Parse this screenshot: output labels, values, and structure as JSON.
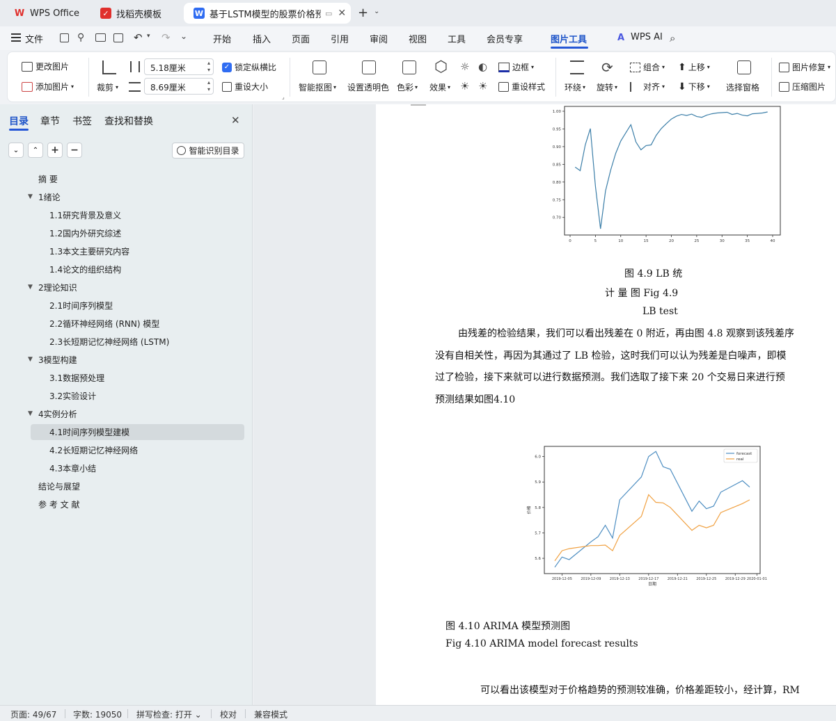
{
  "tabs": [
    {
      "label": "WPS Office",
      "icon": "wps-logo-icon"
    },
    {
      "label": "找稻壳模板",
      "icon": "daoke-icon"
    },
    {
      "label": "基于LSTM模型的股票价格预测",
      "icon": "writer-doc-icon"
    }
  ],
  "menu": {
    "file": "文件",
    "items": [
      "开始",
      "插入",
      "页面",
      "引用",
      "审阅",
      "视图",
      "工具",
      "会员专享",
      "图片工具"
    ],
    "active": "图片工具",
    "wps_ai": "WPS AI"
  },
  "ribbon": {
    "change_image": "更改图片",
    "add_image": "添加图片",
    "crop": "裁剪",
    "width_value": "5.18厘米",
    "height_value": "8.69厘米",
    "lock_ratio": "锁定纵横比",
    "reset_size": "重设大小",
    "smart_cutout": "智能抠图",
    "set_transparent": "设置透明色",
    "color": "色彩",
    "effects": "效果",
    "border": "边框",
    "reset_style": "重设样式",
    "wrap": "环绕",
    "rotate": "旋转",
    "group": "组合",
    "align": "对齐",
    "move_up": "上移",
    "move_down": "下移",
    "selection_pane": "选择窗格",
    "repair": "图片修复",
    "compress": "压缩图片"
  },
  "nav": {
    "tabs": [
      "目录",
      "章节",
      "书签",
      "查找和替换"
    ],
    "active_tab": "目录",
    "smart_toc": "智能识别目录",
    "items": [
      {
        "label": "摘 要",
        "level": 1,
        "expand": ""
      },
      {
        "label": "1绪论",
        "level": 1,
        "expand": "▼"
      },
      {
        "label": "1.1研究背景及意义",
        "level": 2,
        "expand": ""
      },
      {
        "label": "1.2国内外研究综述",
        "level": 2,
        "expand": ""
      },
      {
        "label": "1.3本文主要研究内容",
        "level": 2,
        "expand": ""
      },
      {
        "label": "1.4论文的组织结构",
        "level": 2,
        "expand": ""
      },
      {
        "label": "2理论知识",
        "level": 1,
        "expand": "▼"
      },
      {
        "label": "2.1时间序列模型",
        "level": 2,
        "expand": ""
      },
      {
        "label": "2.2循环神经网络 (RNN) 模型",
        "level": 2,
        "expand": ""
      },
      {
        "label": "2.3长短期记忆神经网络 (LSTM)",
        "level": 2,
        "expand": ""
      },
      {
        "label": "3模型构建",
        "level": 1,
        "expand": "▼"
      },
      {
        "label": "3.1数据预处理",
        "level": 2,
        "expand": ""
      },
      {
        "label": "3.2实验设计",
        "level": 2,
        "expand": ""
      },
      {
        "label": "4实例分析",
        "level": 1,
        "expand": "▼"
      },
      {
        "label": "4.1时间序列模型建模",
        "level": 2,
        "expand": "",
        "selected": true
      },
      {
        "label": "4.2长短期记忆神经网络",
        "level": 2,
        "expand": ""
      },
      {
        "label": "4.3本章小结",
        "level": 2,
        "expand": ""
      },
      {
        "label": "结论与展望",
        "level": 1,
        "expand": ""
      },
      {
        "label": "参 考 文 献",
        "level": 1,
        "expand": ""
      }
    ]
  },
  "doc": {
    "cap49_line1": "图 4.9    LB    统",
    "cap49_line2": "计  量  图   Fig    4.9",
    "cap49_line3": "LB test",
    "para1_line1": "由残差的检验结果，我们可以看出残差在  0 附近，再由图  4.8 观察到该残差序",
    "para1_line2": "没有自相关性，再因为其通过了  LB 检验，这时我们可以认为残差是白噪声，即模",
    "para1_line3": "过了检验，接下来就可以进行数据预测。我们选取了接下来  20 个交易日来进行预",
    "para1_line4": "预测结果如图4.10",
    "cap410_cn": "图 4.10      ARIMA 模型预测图",
    "cap410_en": "Fig 4.10      ARIMA model forecast results",
    "para2": "可以看出该模型对于价格趋势的预测较准确，价格差距较小，经计算，RM"
  },
  "chart_data": [
    {
      "type": "line",
      "title": "",
      "xlabel": "",
      "ylabel": "",
      "xlim": [
        0,
        40
      ],
      "ylim": [
        0.67,
        1.0
      ],
      "xticks": [
        0,
        5,
        10,
        15,
        20,
        25,
        30,
        35,
        40
      ],
      "yticks": [
        0.7,
        0.75,
        0.8,
        0.85,
        0.9,
        0.95,
        1.0
      ],
      "x": [
        1,
        2,
        3,
        4,
        5,
        6,
        7,
        8,
        9,
        10,
        11,
        12,
        13,
        14,
        15,
        16,
        17,
        18,
        19,
        20,
        21,
        22,
        23,
        24,
        25,
        26,
        27,
        28,
        29,
        30,
        31,
        32,
        33,
        34,
        35,
        36,
        37,
        38,
        39
      ],
      "series": [
        {
          "color": "#3b7ea8",
          "values": [
            0.842,
            0.832,
            0.905,
            0.951,
            0.788,
            0.668,
            0.775,
            0.833,
            0.881,
            0.916,
            0.939,
            0.962,
            0.913,
            0.891,
            0.903,
            0.905,
            0.932,
            0.951,
            0.965,
            0.978,
            0.986,
            0.991,
            0.988,
            0.992,
            0.985,
            0.983,
            0.989,
            0.993,
            0.995,
            0.996,
            0.997,
            0.991,
            0.994,
            0.989,
            0.987,
            0.993,
            0.994,
            0.995,
            0.998
          ]
        }
      ]
    },
    {
      "type": "line",
      "title": "",
      "xlabel": "日期",
      "ylabel": "价格",
      "ylim": [
        5.54,
        6.04
      ],
      "yticks": [
        5.6,
        5.7,
        5.8,
        5.9,
        6.0
      ],
      "xticks": [
        "2019-12-05",
        "2019-12-09",
        "2019-12-13",
        "2019-12-17",
        "2019-12-21",
        "2019-12-25",
        "2019-12-29",
        "2020-01-01"
      ],
      "x": [
        "2019-12-04",
        "2019-12-05",
        "2019-12-06",
        "2019-12-09",
        "2019-12-10",
        "2019-12-11",
        "2019-12-12",
        "2019-12-13",
        "2019-12-16",
        "2019-12-17",
        "2019-12-18",
        "2019-12-19",
        "2019-12-20",
        "2019-12-23",
        "2019-12-24",
        "2019-12-25",
        "2019-12-26",
        "2019-12-27",
        "2019-12-30",
        "2019-12-31"
      ],
      "legend": {
        "position": "top-right"
      },
      "series": [
        {
          "name": "forecast",
          "color": "#4c8dc1",
          "values": [
            5.565,
            5.605,
            5.595,
            5.665,
            5.685,
            5.73,
            5.68,
            5.83,
            5.92,
            6.0,
            6.02,
            5.96,
            5.95,
            5.785,
            5.825,
            5.795,
            5.805,
            5.86,
            5.905,
            5.88
          ]
        },
        {
          "name": "real",
          "color": "#f0a040",
          "values": [
            5.59,
            5.63,
            5.638,
            5.65,
            5.65,
            5.652,
            5.63,
            5.69,
            5.765,
            5.85,
            5.82,
            5.818,
            5.8,
            5.71,
            5.73,
            5.72,
            5.73,
            5.78,
            5.815,
            5.83
          ]
        }
      ]
    }
  ]
}
